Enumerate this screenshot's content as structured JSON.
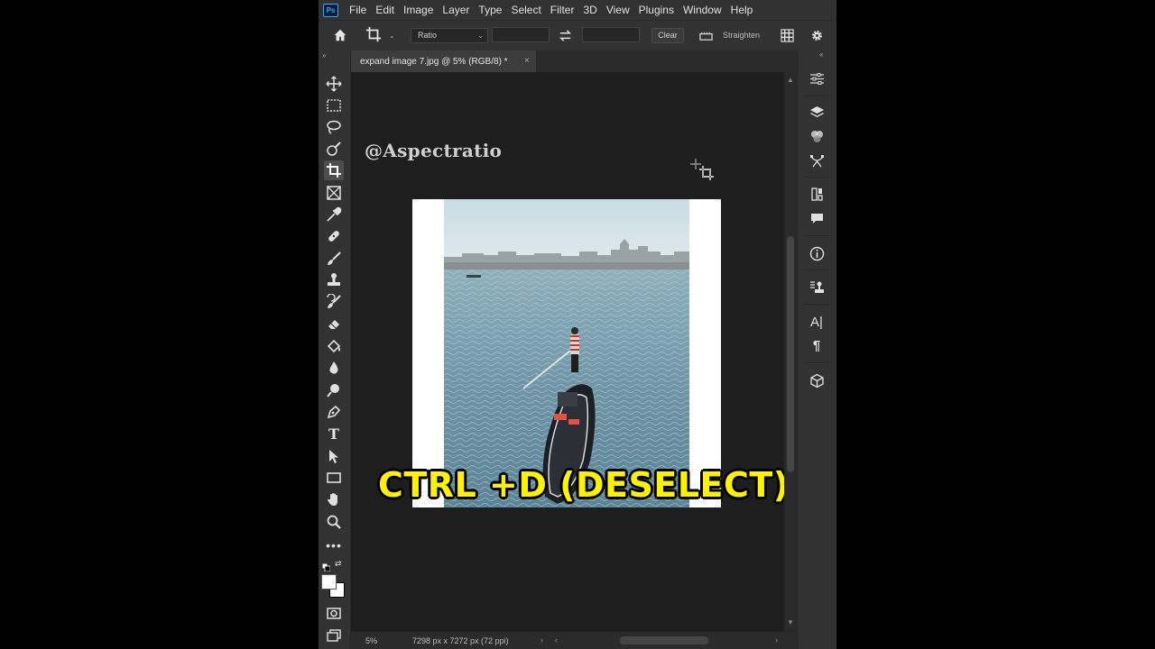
{
  "app": {
    "logo_text": "Ps",
    "menu": [
      "File",
      "Edit",
      "Image",
      "Layer",
      "Type",
      "Select",
      "Filter",
      "3D",
      "View",
      "Plugins",
      "Window",
      "Help"
    ]
  },
  "options_bar": {
    "ratio_value": "Ratio",
    "clear_label": "Clear",
    "straighten_label": "Straighten"
  },
  "document": {
    "tab_title": "expand image 7.jpg @ 5% (RGB/8) *",
    "close_glyph": "×"
  },
  "canvas": {
    "watermark": "@Aspectratio",
    "overlay_caption": "CTRL +D (DESELECT)"
  },
  "status": {
    "zoom": "5%",
    "doc_size": "7298 px x 7272 px (72 ppi)"
  },
  "colors": {
    "caption": "#fff200",
    "ui_dark": "#323232",
    "canvas_bg": "#1e1e1e"
  }
}
